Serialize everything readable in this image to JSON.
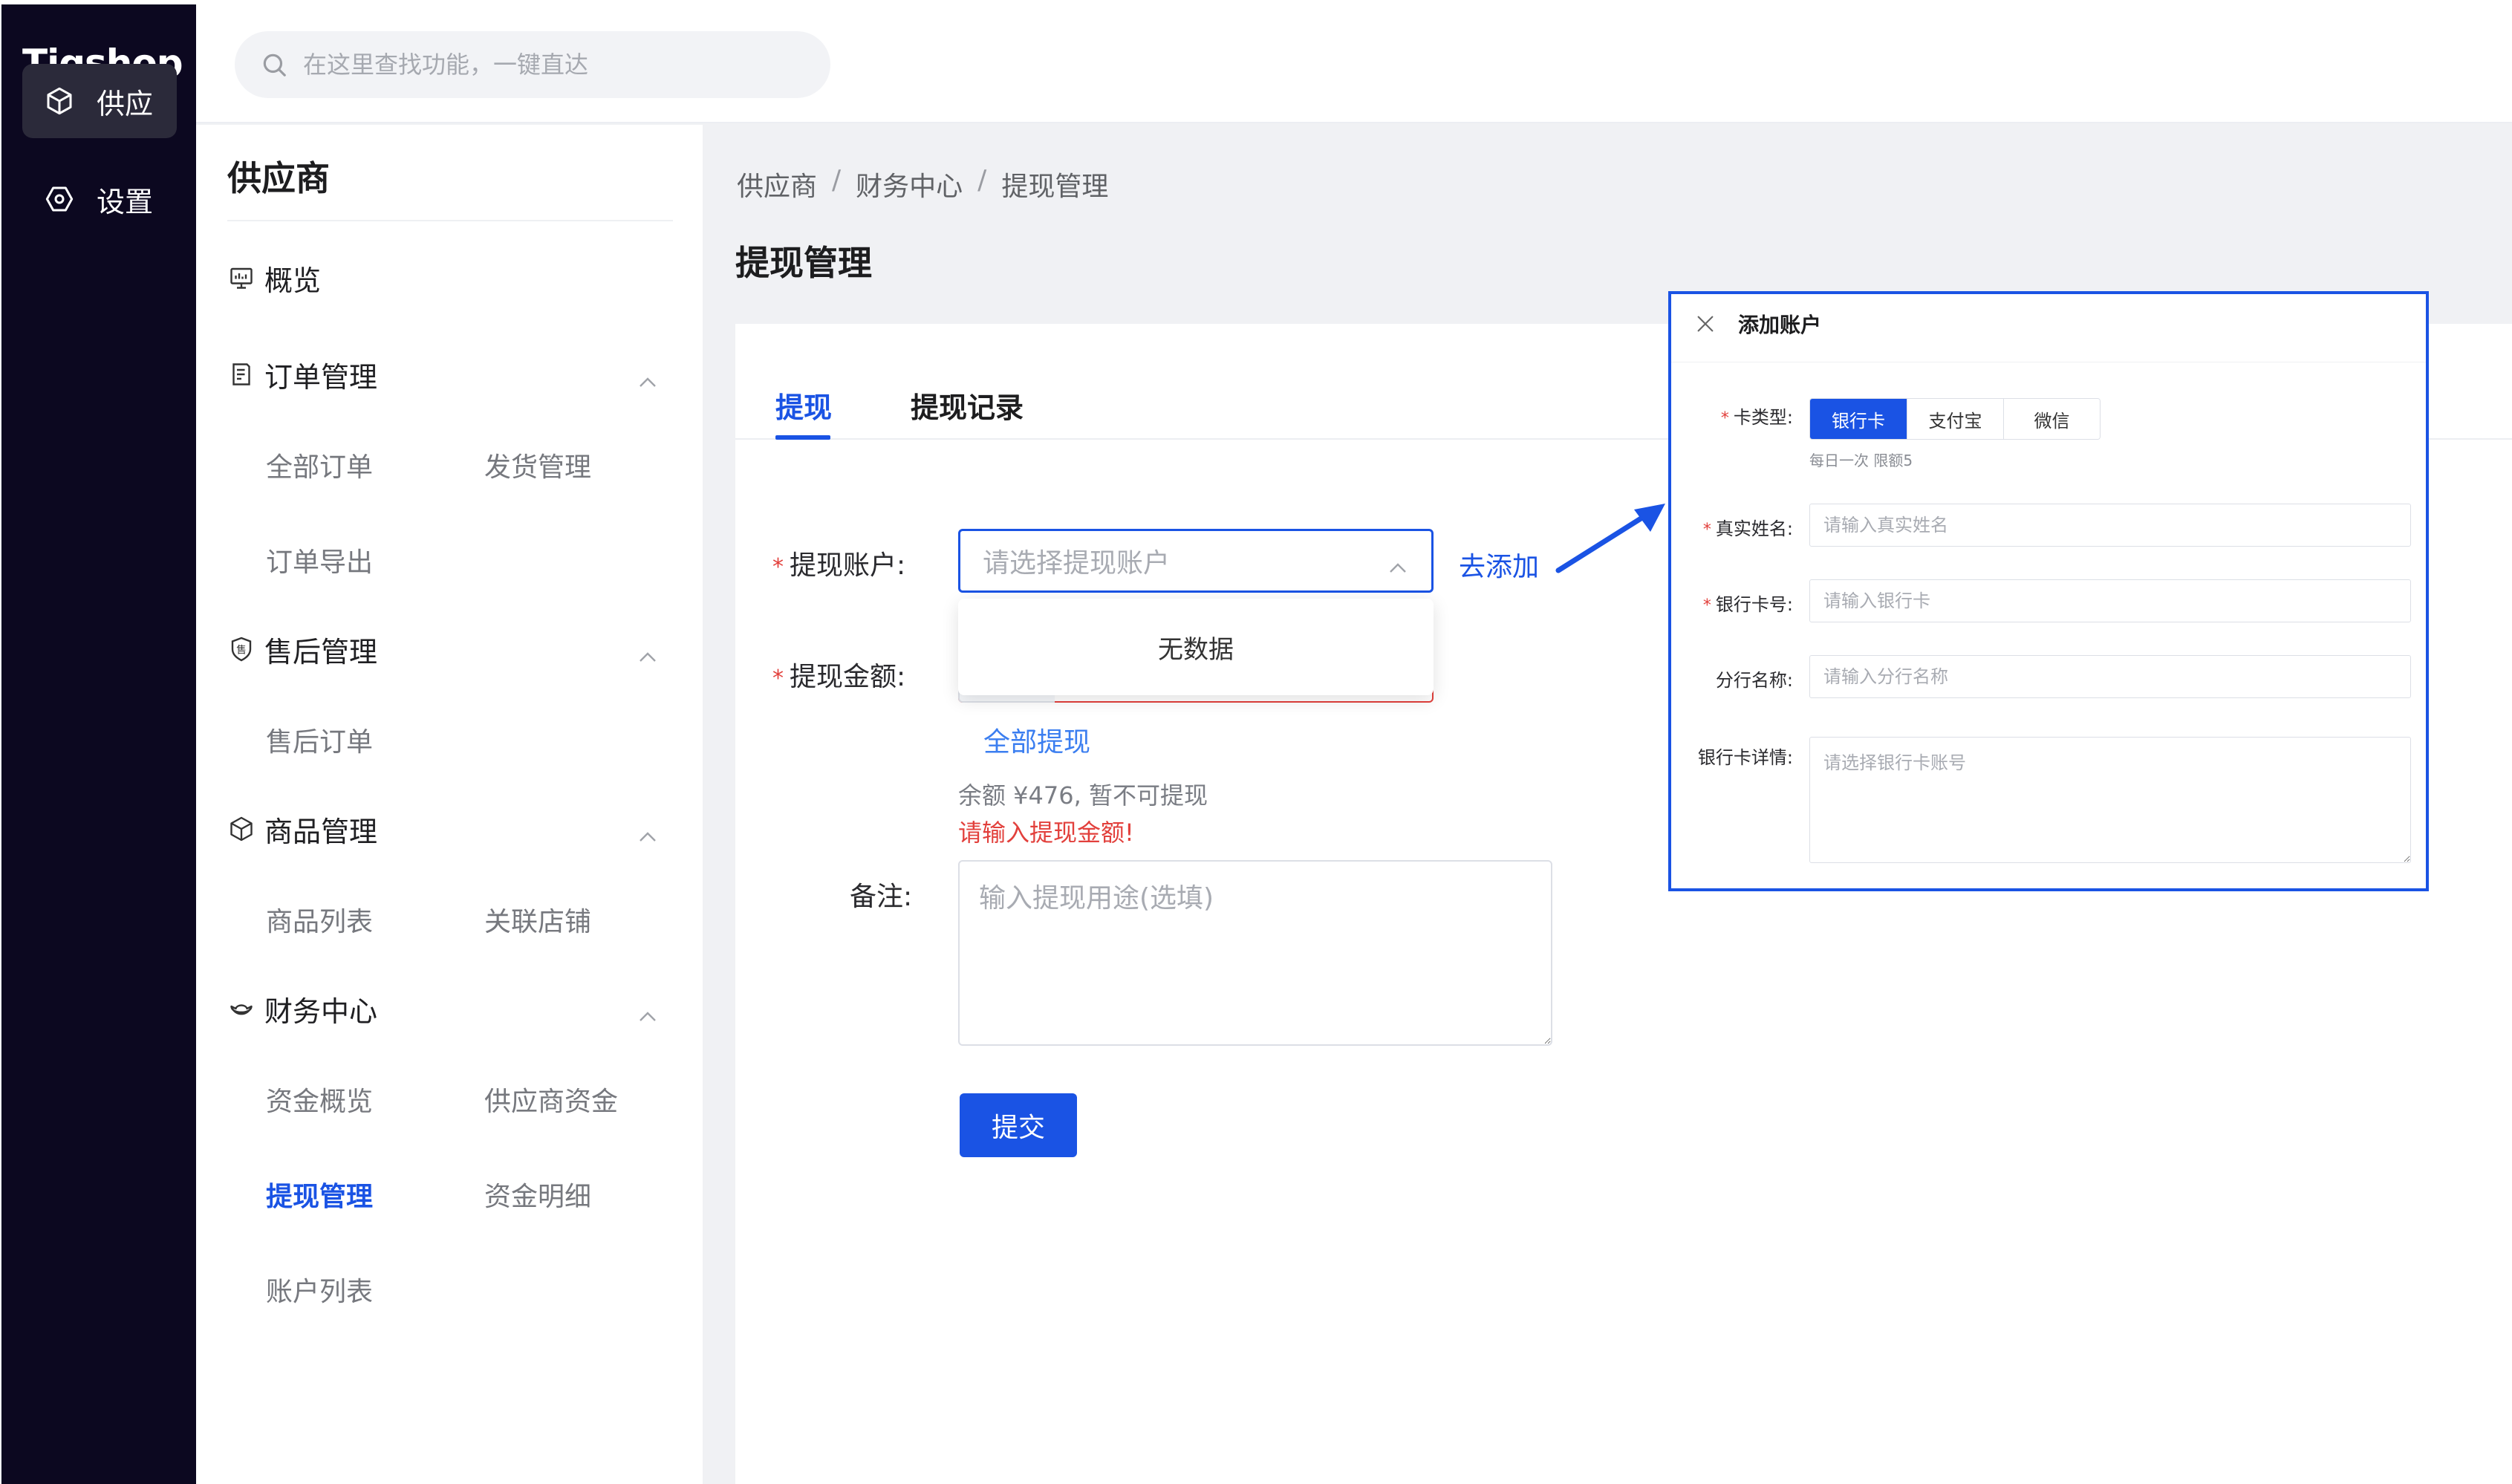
{
  "brand": {
    "logo_text": "Tigshop"
  },
  "rail": {
    "items": [
      {
        "label": "供应",
        "icon": "cube-icon",
        "active": true
      },
      {
        "label": "设置",
        "icon": "settings-icon",
        "active": false
      }
    ]
  },
  "header": {
    "search_placeholder": "在这里查找功能，一键直达"
  },
  "sidebar": {
    "title": "供应商",
    "overview": "概览",
    "groups": [
      {
        "label": "订单管理",
        "children": [
          "全部订单",
          "发货管理",
          "订单导出"
        ]
      },
      {
        "label": "售后管理",
        "children": [
          "售后订单"
        ]
      },
      {
        "label": "商品管理",
        "children": [
          "商品列表",
          "关联店铺"
        ]
      },
      {
        "label": "财务中心",
        "children": [
          "资金概览",
          "供应商资金",
          "提现管理",
          "资金明细",
          "账户列表"
        ]
      }
    ],
    "active_item": "提现管理"
  },
  "breadcrumb": [
    "供应商",
    "财务中心",
    "提现管理"
  ],
  "breadcrumb_sep": "/",
  "page": {
    "title": "提现管理",
    "tabs": [
      "提现",
      "提现记录"
    ],
    "active_tab": "提现"
  },
  "form": {
    "required_mark": "*",
    "account_label": "提现账户:",
    "account_placeholder": "请选择提现账户",
    "add_link": "去添加",
    "dropdown_empty": "无数据",
    "amount_label": "提现金额:",
    "withdraw_all": "全部提现",
    "balance_text": "余额 ¥476, 暂不可提现",
    "error_text": "请输入提现金额!",
    "remark_label": "备注:",
    "remark_placeholder": "输入提现用途(选填)",
    "submit_label": "提交"
  },
  "dialog": {
    "title": "添加账户",
    "card_type_label": "卡类型:",
    "card_types": [
      "银行卡",
      "支付宝",
      "微信"
    ],
    "selected_card_type": "银行卡",
    "hint": "每日一次 限额5",
    "name_label": "真实姓名:",
    "name_placeholder": "请输入真实姓名",
    "card_no_label": "银行卡号:",
    "card_no_placeholder": "请输入银行卡",
    "branch_label": "分行名称:",
    "branch_placeholder": "请输入分行名称",
    "detail_label": "银行卡详情:",
    "detail_placeholder": "请选择银行卡账号"
  },
  "colors": {
    "primary": "#1a53e4",
    "error": "#e2403c",
    "rail_bg": "#0c0820"
  }
}
